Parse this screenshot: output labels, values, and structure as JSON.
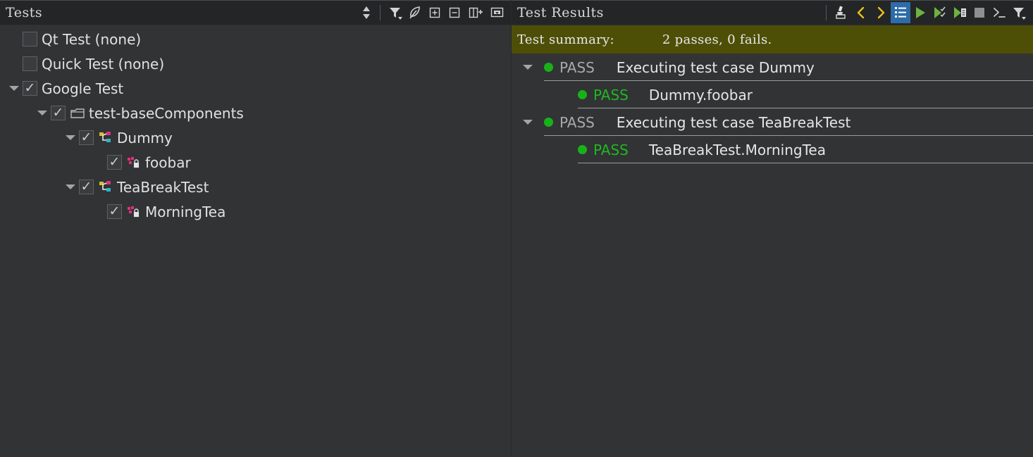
{
  "left_panel": {
    "title": "Tests",
    "toolbar": [
      {
        "name": "sort-order-icon",
        "label": "Sort"
      },
      {
        "name": "filter-icon",
        "label": "Filter"
      },
      {
        "name": "leaf-icon",
        "label": "Leaf"
      },
      {
        "name": "expand-all-icon",
        "label": "Expand All"
      },
      {
        "name": "collapse-all-icon",
        "label": "Collapse All"
      },
      {
        "name": "add-to-group-icon",
        "label": "Group"
      },
      {
        "name": "options-dropdown-icon",
        "label": "Options"
      }
    ],
    "tree": [
      {
        "label": "Qt Test (none)",
        "indent": 0,
        "expander": "none",
        "checkbox": "unchecked",
        "icon": "none"
      },
      {
        "label": "Quick Test (none)",
        "indent": 0,
        "expander": "none",
        "checkbox": "unchecked",
        "icon": "none"
      },
      {
        "label": "Google Test",
        "indent": 0,
        "expander": "expanded",
        "checkbox": "checked",
        "icon": "none"
      },
      {
        "label": "test-baseComponents",
        "indent": 1,
        "expander": "expanded",
        "checkbox": "checked",
        "icon": "folder-icon"
      },
      {
        "label": "Dummy",
        "indent": 2,
        "expander": "expanded",
        "checkbox": "checked",
        "icon": "class-icon"
      },
      {
        "label": "foobar",
        "indent": 3,
        "expander": "none",
        "checkbox": "checked",
        "icon": "private-method-icon"
      },
      {
        "label": "TeaBreakTest",
        "indent": 2,
        "expander": "expanded",
        "checkbox": "checked",
        "icon": "class-icon"
      },
      {
        "label": "MorningTea",
        "indent": 3,
        "expander": "none",
        "checkbox": "checked",
        "icon": "private-method-icon"
      }
    ]
  },
  "right_panel": {
    "title": "Test Results",
    "toolbar": [
      {
        "name": "clear-results-icon",
        "label": "Clear"
      },
      {
        "name": "previous-result-icon",
        "label": "Previous"
      },
      {
        "name": "next-result-icon",
        "label": "Next"
      },
      {
        "name": "output-list-icon",
        "label": "Output",
        "active": true
      },
      {
        "name": "run-icon",
        "label": "Run"
      },
      {
        "name": "run-selected-tests-icon",
        "label": "Run Selected Tests"
      },
      {
        "name": "run-file-tests-icon",
        "label": "Run Tests for Current File"
      },
      {
        "name": "stop-icon",
        "label": "Stop"
      },
      {
        "name": "terminal-icon",
        "label": "Terminal"
      },
      {
        "name": "results-filter-icon",
        "label": "Filter"
      }
    ],
    "summary": {
      "label": "Test summary:",
      "value": "2 passes, 0 fails."
    },
    "results": [
      {
        "level": 0,
        "expander": "expanded",
        "status": "PASS",
        "status_color": "gray",
        "message": "Executing test case Dummy"
      },
      {
        "level": 1,
        "expander": "none",
        "status": "PASS",
        "status_color": "green",
        "message": "Dummy.foobar"
      },
      {
        "level": 0,
        "expander": "expanded",
        "status": "PASS",
        "status_color": "gray",
        "message": "Executing test case TeaBreakTest"
      },
      {
        "level": 1,
        "expander": "none",
        "status": "PASS",
        "status_color": "green",
        "message": "TeaBreakTest.MorningTea"
      }
    ]
  },
  "colors": {
    "header_bg": "#232527",
    "panel_bg": "#323335",
    "summary_bg": "#4e4f06",
    "pass_green": "#1fb81f",
    "pass_gray": "#a7a9ab",
    "active_tool": "#2d6ca8",
    "chevron_yellow": "#e8c020",
    "run_green": "#6cb33f"
  }
}
